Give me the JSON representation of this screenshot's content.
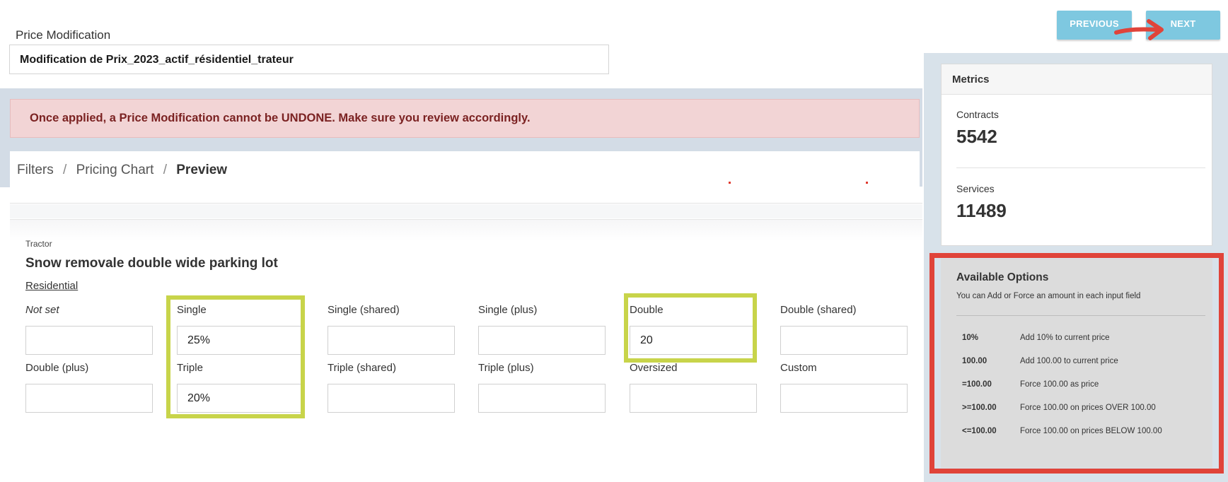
{
  "header": {
    "label": "Price Modification",
    "name_value": "Modification de Prix_2023_actif_résidentiel_trateur",
    "prev_label": "PREVIOUS",
    "next_label": "NEXT"
  },
  "alert": {
    "text": "Once applied, a Price Modification cannot be UNDONE. Make sure you review accordingly."
  },
  "breadcrumb": {
    "items": [
      "Filters",
      "Pricing Chart",
      "Preview"
    ],
    "separator": "/"
  },
  "service": {
    "category": "Tractor",
    "title": "Snow removale double wide parking lot",
    "zone": "Residential",
    "fields": [
      {
        "label": "Not set",
        "value": ""
      },
      {
        "label": "Single",
        "value": "25%"
      },
      {
        "label": "Single (shared)",
        "value": ""
      },
      {
        "label": "Single (plus)",
        "value": ""
      },
      {
        "label": "Double",
        "value": "20"
      },
      {
        "label": "Double (shared)",
        "value": ""
      },
      {
        "label": "Double (plus)",
        "value": ""
      },
      {
        "label": "Triple",
        "value": "20%"
      },
      {
        "label": "Triple (shared)",
        "value": ""
      },
      {
        "label": "Triple (plus)",
        "value": ""
      },
      {
        "label": "Oversized",
        "value": ""
      },
      {
        "label": "Custom",
        "value": ""
      }
    ]
  },
  "metrics": {
    "title": "Metrics",
    "contracts_label": "Contracts",
    "contracts_value": "5542",
    "services_label": "Services",
    "services_value": "11489"
  },
  "options": {
    "title": "Available Options",
    "subtitle": "You can Add or Force an amount in each input field",
    "rows": [
      {
        "code": "10%",
        "desc": "Add 10% to current price"
      },
      {
        "code": "100.00",
        "desc": "Add 100.00 to current price"
      },
      {
        "code": "=100.00",
        "desc": "Force 100.00 as price"
      },
      {
        "code": ">=100.00",
        "desc": "Force 100.00 on prices OVER 100.00"
      },
      {
        "code": "<=100.00",
        "desc": "Force 100.00 on prices BELOW 100.00"
      }
    ]
  },
  "colors": {
    "button": "#7ec8e0",
    "alert_bg": "#f2d4d5",
    "alert_text": "#7b2222",
    "highlight_green": "#c8d44a",
    "highlight_red": "#e0443a",
    "arrow_red": "#e0443a"
  }
}
